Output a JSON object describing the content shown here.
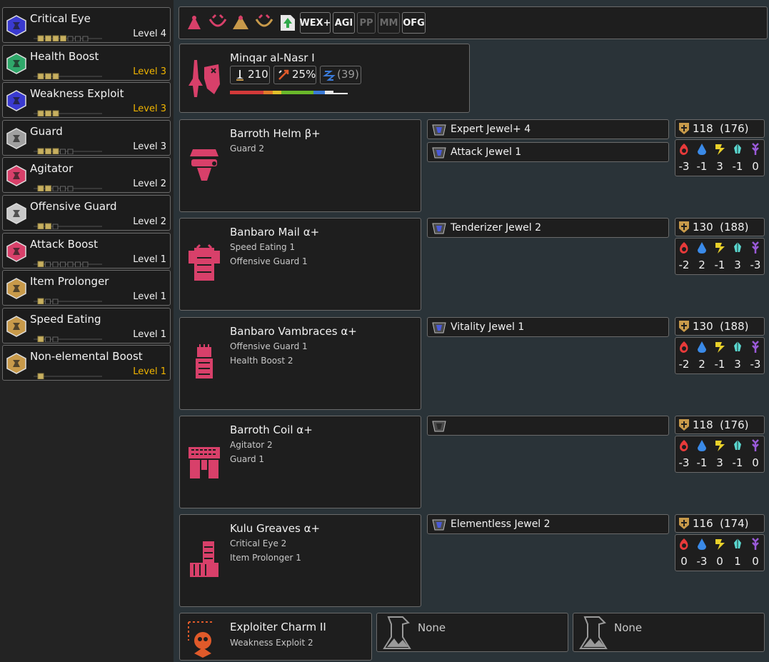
{
  "skills": [
    {
      "name": "Critical Eye",
      "level": "Level 4",
      "filled": 4,
      "total": 7,
      "max": false,
      "color": "#3a3ad0"
    },
    {
      "name": "Health Boost",
      "level": "Level 3",
      "filled": 3,
      "total": 3,
      "max": true,
      "color": "#2fa86a"
    },
    {
      "name": "Weakness Exploit",
      "level": "Level 3",
      "filled": 3,
      "total": 3,
      "max": true,
      "color": "#3a3ad0"
    },
    {
      "name": "Guard",
      "level": "Level 3",
      "filled": 3,
      "total": 5,
      "max": false,
      "color": "#a0a0a0"
    },
    {
      "name": "Agitator",
      "level": "Level 2",
      "filled": 2,
      "total": 5,
      "max": false,
      "color": "#d8406a"
    },
    {
      "name": "Offensive Guard",
      "level": "Level 2",
      "filled": 2,
      "total": 3,
      "max": false,
      "color": "#c8c8c8"
    },
    {
      "name": "Attack Boost",
      "level": "Level 1",
      "filled": 1,
      "total": 7,
      "max": false,
      "color": "#d8406a"
    },
    {
      "name": "Item Prolonger",
      "level": "Level 1",
      "filled": 1,
      "total": 3,
      "max": false,
      "color": "#c89a4a"
    },
    {
      "name": "Speed Eating",
      "level": "Level 1",
      "filled": 1,
      "total": 3,
      "max": false,
      "color": "#c89a4a"
    },
    {
      "name": "Non-elemental Boost",
      "level": "Level 1",
      "filled": 1,
      "total": 1,
      "max": true,
      "color": "#c89a4a"
    }
  ],
  "toolbar": {
    "buttons": [
      {
        "label": "WEX+",
        "active": true
      },
      {
        "label": "AGI",
        "active": true
      },
      {
        "label": "PP",
        "active": false
      },
      {
        "label": "MM",
        "active": false
      },
      {
        "label": "OFG",
        "active": true
      }
    ],
    "icon_names": [
      "monster-icon-1",
      "monster-icon-2",
      "monster-icon-3",
      "monster-icon-4",
      "upgrade-icon"
    ]
  },
  "weapon": {
    "name": "Minqar al-Nasr I",
    "attack": "210",
    "affinity": "25%",
    "element": "(39)",
    "sharpness": [
      {
        "color": "#d33a3a",
        "pct": 27
      },
      {
        "color": "#e07a2a",
        "pct": 7
      },
      {
        "color": "#e0c02a",
        "pct": 7
      },
      {
        "color": "#6ab82a",
        "pct": 26
      },
      {
        "color": "#3a7ad8",
        "pct": 9
      },
      {
        "color": "#e8e8e8",
        "pct": 7
      },
      {
        "color": "#ffffff",
        "pct": 11
      }
    ]
  },
  "armor": [
    {
      "name": "Barroth Helm β+",
      "skills": [
        "Guard 2"
      ],
      "decos": [
        {
          "name": "Expert Jewel+ 4"
        },
        {
          "name": "Attack Jewel 1"
        }
      ],
      "defense": "118  (176)",
      "res": [
        "-3",
        "-1",
        "3",
        "-1",
        "0"
      ]
    },
    {
      "name": "Banbaro Mail α+",
      "skills": [
        "Speed Eating 1",
        "Offensive Guard 1"
      ],
      "decos": [
        {
          "name": "Tenderizer Jewel 2"
        }
      ],
      "defense": "130  (188)",
      "res": [
        "-2",
        "2",
        "-1",
        "3",
        "-3"
      ]
    },
    {
      "name": "Banbaro Vambraces α+",
      "skills": [
        "Offensive Guard 1",
        "Health Boost 2"
      ],
      "decos": [
        {
          "name": "Vitality Jewel 1"
        }
      ],
      "defense": "130  (188)",
      "res": [
        "-2",
        "2",
        "-1",
        "3",
        "-3"
      ]
    },
    {
      "name": "Barroth Coil α+",
      "skills": [
        "Agitator 2",
        "Guard 1"
      ],
      "decos": [
        {
          "name": ""
        }
      ],
      "defense": "118  (176)",
      "res": [
        "-3",
        "-1",
        "3",
        "-1",
        "0"
      ]
    },
    {
      "name": "Kulu Greaves α+",
      "skills": [
        "Critical Eye 2",
        "Item Prolonger 1"
      ],
      "decos": [
        {
          "name": "Elementless Jewel 2"
        }
      ],
      "defense": "116  (174)",
      "res": [
        "0",
        "-3",
        "0",
        "1",
        "0"
      ]
    }
  ],
  "charm": {
    "name": "Exploiter Charm II",
    "skill": "Weakness Exploit 2"
  },
  "extra_slots": [
    {
      "label": "None"
    },
    {
      "label": "None"
    }
  ],
  "colors": {
    "accent_gold": "#f0b400",
    "armor_pink": "#d8406a"
  }
}
